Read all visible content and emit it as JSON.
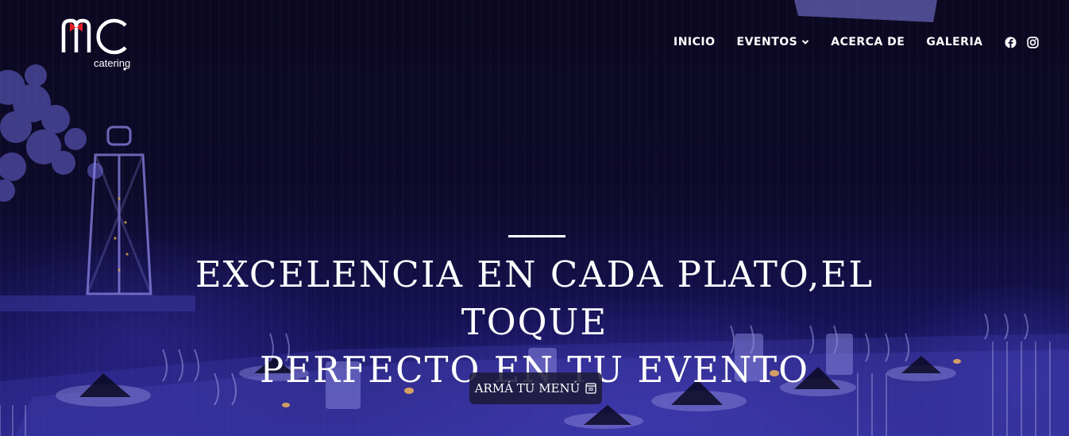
{
  "brand": {
    "logo_text": "nC",
    "logo_subtext": "catering",
    "accent_color": "#e3202a"
  },
  "nav": {
    "items": [
      {
        "label": "INICIO"
      },
      {
        "label": "EVENTOS",
        "has_dropdown": true,
        "icon": "chevron-down-icon"
      },
      {
        "label": "ACERCA DE"
      },
      {
        "label": "GALERIA"
      }
    ],
    "social": [
      "facebook-icon",
      "instagram-icon"
    ]
  },
  "hero": {
    "headline_line1": "EXCELENCIA EN CADA PLATO,EL TOQUE",
    "headline_line2": "PERFECTO EN TU EVENTO",
    "cta_label": "ARMÁ TU MENÚ",
    "cta_icon": "menu-list-icon"
  },
  "colors": {
    "background": "#0d0a2a",
    "ambient_light": "#2f28a0",
    "text": "#ffffff"
  }
}
